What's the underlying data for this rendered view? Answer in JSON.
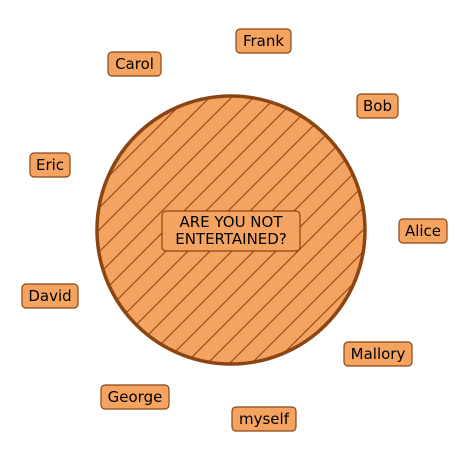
{
  "center_label": {
    "lines": [
      "ARE YOU NOT",
      "ENTERTAINED?"
    ]
  },
  "people": [
    {
      "id": "alice",
      "name": "Alice"
    },
    {
      "id": "bob",
      "name": "Bob"
    },
    {
      "id": "frank",
      "name": "Frank"
    },
    {
      "id": "carol",
      "name": "Carol"
    },
    {
      "id": "eric",
      "name": "Eric"
    },
    {
      "id": "david",
      "name": "David"
    },
    {
      "id": "george",
      "name": "George"
    },
    {
      "id": "myself",
      "name": "myself"
    },
    {
      "id": "mallory",
      "name": "Mallory"
    }
  ],
  "colors": {
    "fill": "#f4a460",
    "stroke": "#8b4513",
    "text": "#000000"
  }
}
